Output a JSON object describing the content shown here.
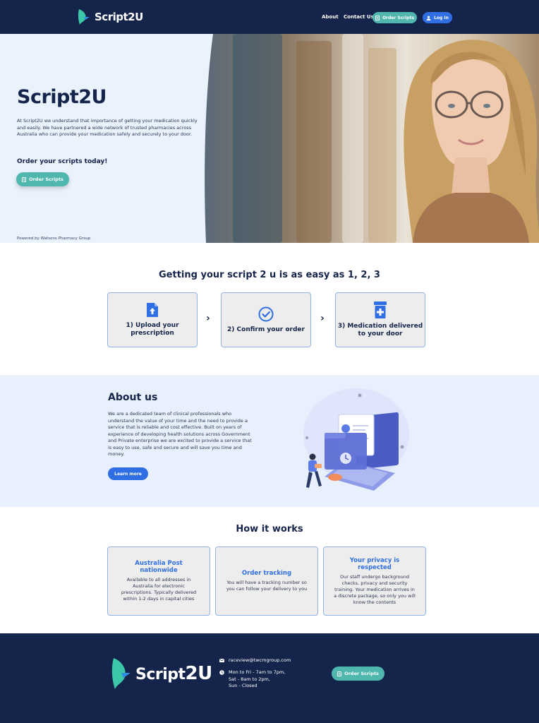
{
  "brand": {
    "name_prefix": "Script",
    "name_suffix": "2U"
  },
  "nav": {
    "about": "About",
    "contact": "Contact Us",
    "order_scripts": "Order Scripts",
    "login": "Log In"
  },
  "hero": {
    "title": "Script2U",
    "body": "At Script2U we understand that importance of getting your medication quickly and easily. We have partnered a wide network of trusted pharmacies across Australia who can provide your medication safely and securely to your door.",
    "cta": "Order your scripts today!",
    "button": "Order Scripts",
    "powered_by": "Powered by Watsons Pharmacy Group"
  },
  "steps": {
    "title": "Getting your script 2 u is as easy as 1, 2, 3",
    "items": [
      {
        "label": "1) Upload your prescription",
        "icon": "file-upload-icon"
      },
      {
        "label": "2) Confirm your order",
        "icon": "check-circle-icon"
      },
      {
        "label": "3) Medication delivered to your door",
        "icon": "medicine-bottle-icon"
      }
    ]
  },
  "about": {
    "title": "About us",
    "body": "We are a dedicated team of clinical professionals who understand the value of your time and the need to provide a service that is reliable and cost effective. Built on years of experience of developing health solutions across Government and Private enterprise we are excited to provide a service that is easy to use, safe and secure and will save you time and money.",
    "button": "Learn more"
  },
  "how": {
    "title": "How it works",
    "cards": [
      {
        "title": "Australia Post nationwide",
        "body": "Available to all addresses in Australia for electronic prescriptions. Typically delivered within 1-2 days in capital cities"
      },
      {
        "title": "Order tracking",
        "body": "You will have a tracking number so you can follow your delivery to you"
      },
      {
        "title": "Your privacy is respected",
        "body": "Our staff undergo background checks, privacy and security training. Your medication arrives in a discrete package, so only you will know the contents"
      }
    ]
  },
  "footer": {
    "email": "raceview@twcmgroup.com",
    "hours": [
      "Mon to Fri - 7am to 7pm,",
      "Sat - 8am to 2pm,",
      "Sun - Closed"
    ],
    "button": "Order Scripts"
  },
  "colors": {
    "navy": "#14244a",
    "teal": "#4fb7ad",
    "blue": "#2f6fe3",
    "light_blue_bg": "#e7f0fc"
  }
}
